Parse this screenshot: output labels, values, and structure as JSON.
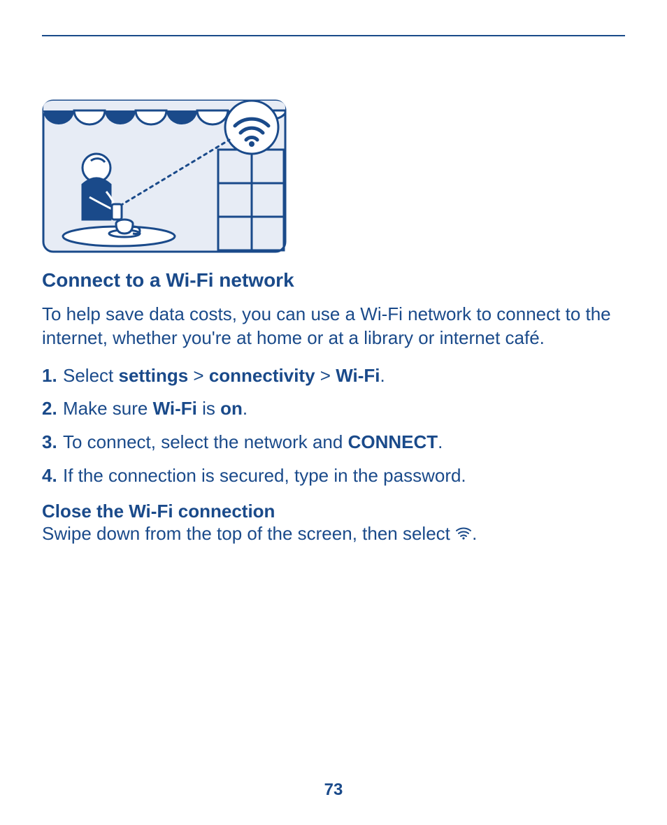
{
  "heading": "Connect to a Wi-Fi network",
  "intro": "To help save data costs, you can use a Wi-Fi network to connect to the internet, whether you're at home or at a library or internet café.",
  "steps": [
    {
      "num": "1.",
      "parts": [
        "Select ",
        "settings",
        " > ",
        "connectivity",
        " > ",
        "Wi-Fi",
        "."
      ]
    },
    {
      "num": "2.",
      "parts": [
        "Make sure ",
        "Wi-Fi",
        " is ",
        "on",
        "."
      ]
    },
    {
      "num": "3.",
      "parts": [
        "To connect, select the network and ",
        "CONNECT",
        "."
      ]
    },
    {
      "num": "4.",
      "parts": [
        "If the connection is secured, type in the password."
      ]
    }
  ],
  "subheading": "Close the Wi-Fi connection",
  "subtext_before": "Swipe down from the top of the screen, then select ",
  "subtext_after": ".",
  "page_number": "73",
  "icons": {
    "wifi_inline": "wifi-icon"
  }
}
